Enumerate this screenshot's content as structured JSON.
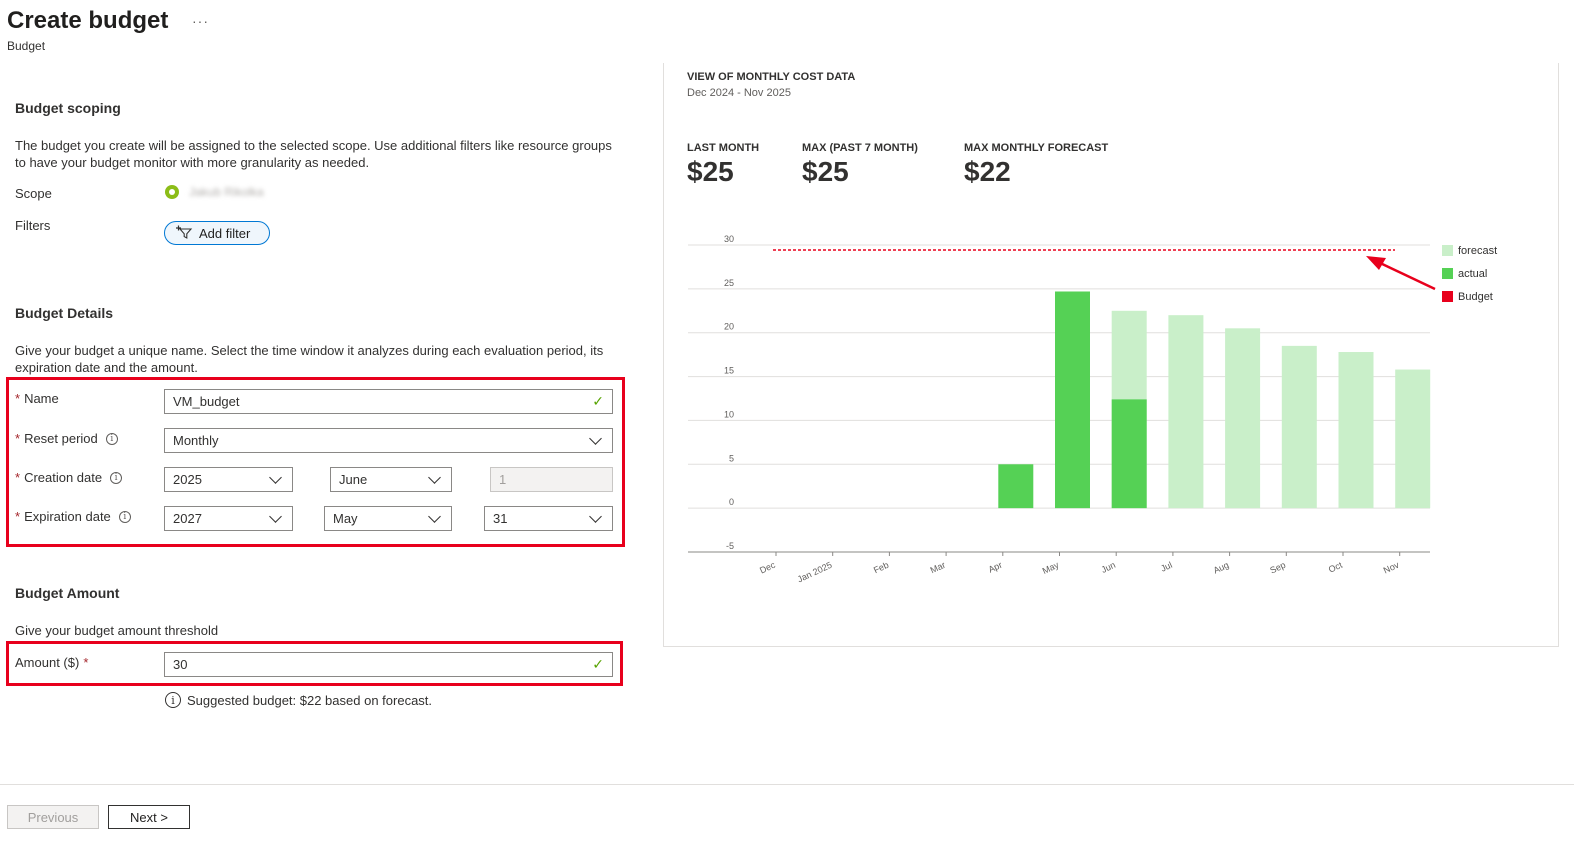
{
  "header": {
    "title": "Create budget",
    "more": "···",
    "subtitle": "Budget"
  },
  "scoping": {
    "heading": "Budget scoping",
    "description": "The budget you create will be assigned to the selected scope. Use additional filters like resource groups to have your budget monitor with more granularity as needed.",
    "scope_label": "Scope",
    "scope_value": "Jakub Rikolka",
    "filters_label": "Filters",
    "add_filter": "Add filter"
  },
  "details": {
    "heading": "Budget Details",
    "description": "Give your budget a unique name. Select the time window it analyzes during each evaluation period, its expiration date and the amount.",
    "name_label": "Name",
    "name_value": "VM_budget",
    "reset_label": "Reset period",
    "reset_value": "Monthly",
    "creation_label": "Creation date",
    "creation_year": "2025",
    "creation_month": "June",
    "creation_day": "1",
    "expiration_label": "Expiration date",
    "expiration_year": "2027",
    "expiration_month": "May",
    "expiration_day": "31",
    "required_mark": "*",
    "info_glyph": "i"
  },
  "amount": {
    "heading": "Budget Amount",
    "description": "Give your budget amount threshold",
    "label": "Amount ($)",
    "value": "30",
    "suggestion": "Suggested budget: $22 based on forecast."
  },
  "footer": {
    "previous": "Previous",
    "next": "Next >"
  },
  "panel": {
    "title": "VIEW OF MONTHLY COST DATA",
    "range": "Dec 2024 - Nov 2025",
    "kpis": [
      {
        "label": "LAST MONTH",
        "value": "$25"
      },
      {
        "label": "MAX (PAST 7 MONTH)",
        "value": "$25"
      },
      {
        "label": "MAX MONTHLY FORECAST",
        "value": "$22"
      }
    ]
  },
  "chart_data": {
    "type": "bar",
    "categories": [
      "Dec",
      "Jan 2025",
      "Feb",
      "Mar",
      "Apr",
      "May",
      "Jun",
      "Jul",
      "Aug",
      "Sep",
      "Oct",
      "Nov"
    ],
    "series": [
      {
        "name": "forecast",
        "values": [
          null,
          null,
          null,
          null,
          null,
          null,
          22.5,
          22,
          20.5,
          18.5,
          17.8,
          15.8
        ],
        "color": "#c9efc9"
      },
      {
        "name": "actual",
        "values": [
          null,
          null,
          null,
          null,
          5,
          24.7,
          12.4,
          null,
          null,
          null,
          null,
          null
        ],
        "color": "#55d155"
      },
      {
        "name": "Budget",
        "values": [
          30,
          30,
          30,
          30,
          30,
          30,
          30,
          30,
          30,
          30,
          30,
          30
        ],
        "color": "#e8001c",
        "style": "dotted-line"
      }
    ],
    "yticks": [
      30,
      25,
      20,
      15,
      10,
      5,
      0,
      -5
    ],
    "ylim": [
      -5,
      30
    ],
    "grid": true,
    "legend": "right"
  },
  "annotation": {
    "arrow_color": "#e8001c",
    "highlight_color": "#e8001c"
  }
}
